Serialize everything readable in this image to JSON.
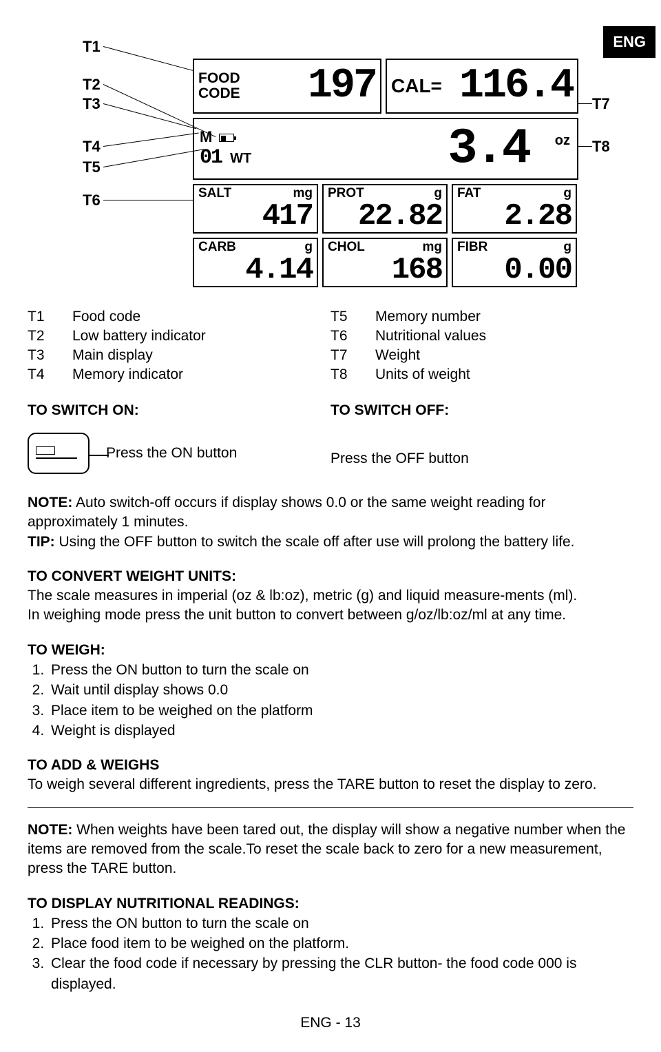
{
  "lang_badge": "ENG",
  "diagram": {
    "t_labels": {
      "t1": "T1",
      "t2": "T2",
      "t3": "T3",
      "t4": "T4",
      "t5": "T5",
      "t6": "T6",
      "t7": "T7",
      "t8": "T8"
    },
    "food_code_label": "FOOD\nCODE",
    "food_code_value": "197",
    "cal_label": "CAL=",
    "cal_value": "116.4",
    "memory_label": "M",
    "memory_number": "01",
    "wt_label": "WT",
    "weight_value": "3.4",
    "weight_unit": "oz",
    "nutrients": [
      {
        "label": "SALT",
        "unit": "mg",
        "value": "417"
      },
      {
        "label": "PROT",
        "unit": "g",
        "value": "22.82"
      },
      {
        "label": "FAT",
        "unit": "g",
        "value": "2.28"
      },
      {
        "label": "CARB",
        "unit": "g",
        "value": "4.14"
      },
      {
        "label": "CHOL",
        "unit": "mg",
        "value": "168"
      },
      {
        "label": "FIBR",
        "unit": "g",
        "value": "0.00"
      }
    ]
  },
  "legend": {
    "left": [
      {
        "key": "T1",
        "desc": "Food code"
      },
      {
        "key": "T2",
        "desc": "Low battery indicator"
      },
      {
        "key": "T3",
        "desc": "Main display"
      },
      {
        "key": "T4",
        "desc": "Memory indicator"
      }
    ],
    "right": [
      {
        "key": "T5",
        "desc": "Memory number"
      },
      {
        "key": "T6",
        "desc": "Nutritional values"
      },
      {
        "key": "T7",
        "desc": "Weight"
      },
      {
        "key": "T8",
        "desc": "Units of weight"
      }
    ]
  },
  "switch": {
    "on_heading": "TO SWITCH ON:",
    "off_heading": "TO SWITCH OFF:",
    "on_text": "Press the ON button",
    "off_text": "Press the OFF button"
  },
  "notes": {
    "note_label": "NOTE:",
    "note_text": " Auto switch-off occurs if display shows 0.0 or the same weight reading for approximately 1 minutes.",
    "tip_label": "TIP:",
    "tip_text": " Using the OFF button to switch the scale off after use will prolong the battery life."
  },
  "convert": {
    "heading": "TO CONVERT WEIGHT UNITS:",
    "line1": "The scale measures in imperial (oz & lb:oz), metric (g) and liquid measure-ments (ml).",
    "line2": "In weighing mode press the unit button to convert between g/oz/lb:oz/ml at any time."
  },
  "weigh": {
    "heading": "TO WEIGH:",
    "steps": [
      "Press the ON button to turn the scale on",
      "Wait until display shows 0.0",
      "Place item to be weighed on the platform",
      "Weight is displayed"
    ]
  },
  "addweighs": {
    "heading": "TO ADD & WEIGHS",
    "text": "To weigh several different ingredients, press the TARE button to reset the display to zero.",
    "note_label": "NOTE:",
    "note_text": " When weights have been tared out, the display will show a negative number when the items are removed from the scale.To reset the scale back to zero for a new measurement, press the TARE button."
  },
  "nutritional": {
    "heading": "TO DISPLAY NUTRITIONAL READINGS:",
    "steps": [
      "Press the ON button to turn the scale on",
      "Place food item to be weighed on the platform.",
      "Clear the food code if necessary by pressing the CLR button- the food code 000 is displayed."
    ]
  },
  "footer": "ENG - 13"
}
